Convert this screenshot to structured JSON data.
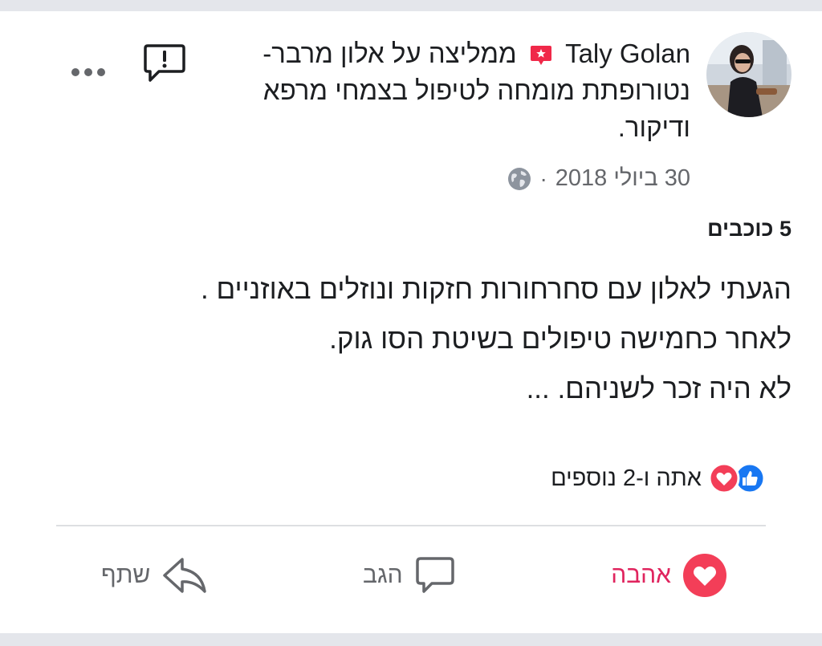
{
  "post": {
    "author": "Taly Golan",
    "recommendation_text": "ממליצה על אלון מרבר- נטורופתת מומחה לטיפול בצמחי מרפא ודיקור.",
    "date": "30 ביולי 2018",
    "separator": "·",
    "rating": "5 כוכבים",
    "body_lines": [
      "הגעתי לאלון עם סחרחורות חזקות ונוזלים באוזניים .",
      "לאחר כחמישה טיפולים בשיטת הסו גוק.",
      "לא היה זכר לשניהם.  ..."
    ],
    "reactions_text": "אתה ו-2 נוספים"
  },
  "actions": {
    "love": "אהבה",
    "comment": "הגב",
    "share": "שתף"
  },
  "colors": {
    "love_red": "#e0245e",
    "like_blue": "#1877f2",
    "muted_text": "#65676b",
    "band_gray": "#e4e6eb"
  },
  "icons": [
    "avatar",
    "recommend-badge-icon",
    "report-icon",
    "more-icon",
    "globe-icon",
    "like-reaction-icon",
    "love-reaction-icon",
    "love-action-icon",
    "comment-icon",
    "share-icon"
  ]
}
